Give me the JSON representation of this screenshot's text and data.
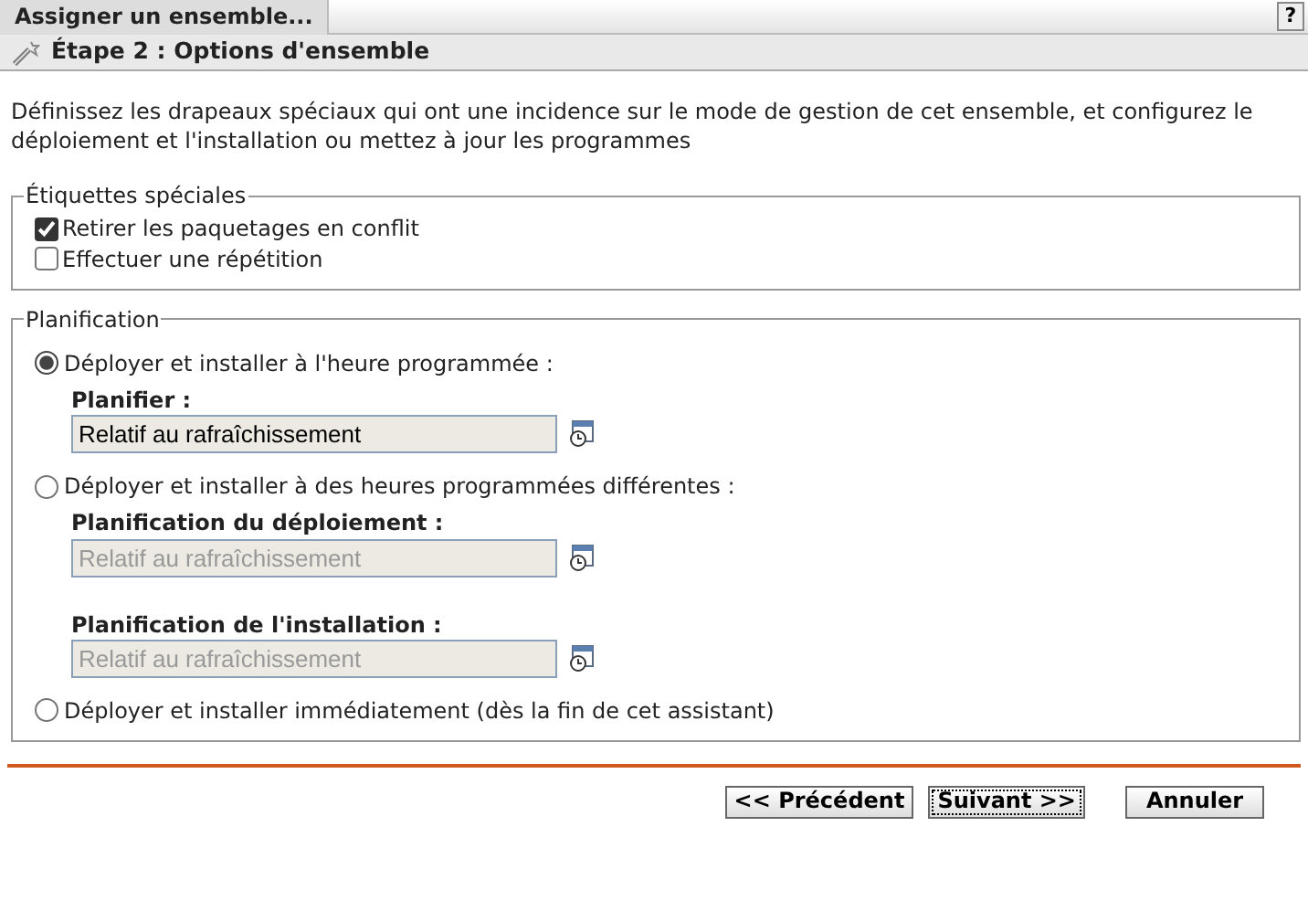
{
  "window": {
    "title": "Assigner un ensemble...",
    "help": "?"
  },
  "step": {
    "title": "Étape 2 : Options d'ensemble"
  },
  "description": "Définissez les drapeaux spéciaux qui ont une incidence sur le mode de gestion de cet ensemble, et configurez le déploiement et l'installation ou mettez à jour les programmes",
  "special_flags": {
    "legend": "Étiquettes spéciales",
    "options": [
      {
        "label": "Retirer les paquetages en conflit",
        "checked": true
      },
      {
        "label": "Effectuer une répétition",
        "checked": false
      }
    ]
  },
  "schedule": {
    "legend": "Planification",
    "options": [
      {
        "label": "Déployer et installer à l'heure programmée :",
        "selected": true,
        "fields": [
          {
            "label": "Planifier :",
            "value": "Relatif au rafraîchissement",
            "disabled": false
          }
        ]
      },
      {
        "label": "Déployer et installer à des heures programmées différentes :",
        "selected": false,
        "fields": [
          {
            "label": "Planification du déploiement :",
            "value": "Relatif au rafraîchissement",
            "disabled": true
          },
          {
            "label": "Planification de l'installation :",
            "value": "Relatif au rafraîchissement",
            "disabled": true
          }
        ]
      },
      {
        "label": "Déployer et installer immédiatement (dès la fin de cet assistant)",
        "selected": false
      }
    ]
  },
  "buttons": [
    {
      "label": "<< Précédent",
      "focused": false
    },
    {
      "label": "Suivant >>",
      "focused": true
    },
    {
      "label": "Annuler",
      "focused": false
    }
  ]
}
